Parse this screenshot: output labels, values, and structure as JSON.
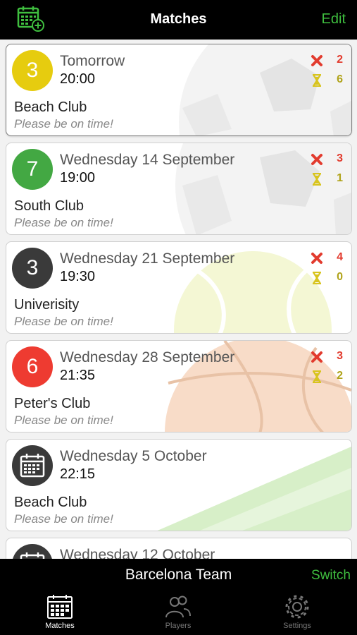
{
  "nav": {
    "title": "Matches",
    "edit_label": "Edit"
  },
  "colors": {
    "accent": "#3fbf3f",
    "no_icon": "#e23b2e",
    "pending_icon": "#d8c41e"
  },
  "matches": [
    {
      "badge": "3",
      "badge_color": "#e6cc0f",
      "badge_kind": "number",
      "date": "Tomorrow",
      "time": "20:00",
      "venue": "Beach Club",
      "note": "Please be on time!",
      "no_count": "2",
      "pending_count": "6",
      "background": "soccer-ball",
      "selected": true
    },
    {
      "badge": "7",
      "badge_color": "#43a843",
      "badge_kind": "number",
      "date": "Wednesday 14 September",
      "time": "19:00",
      "venue": "South Club",
      "note": "Please be on time!",
      "no_count": "3",
      "pending_count": "1",
      "background": "soccer-ball",
      "selected": false
    },
    {
      "badge": "3",
      "badge_color": "#3a3a3a",
      "badge_kind": "number",
      "date": "Wednesday 21 September",
      "time": "19:30",
      "venue": "Univerisity",
      "note": "Please be on time!",
      "no_count": "4",
      "pending_count": "0",
      "background": "tennis-ball",
      "selected": false
    },
    {
      "badge": "6",
      "badge_color": "#ee3b31",
      "badge_kind": "number",
      "date": "Wednesday 28 September",
      "time": "21:35",
      "venue": "Peter's Club",
      "note": "Please be on time!",
      "no_count": "3",
      "pending_count": "2",
      "background": "basketball",
      "selected": false
    },
    {
      "badge": "",
      "badge_color": "#3a3a3a",
      "badge_kind": "calendar",
      "date": "Wednesday 5 October",
      "time": "22:15",
      "venue": "Beach Club",
      "note": "Please be on time!",
      "no_count": "",
      "pending_count": "",
      "background": "grass-field",
      "selected": false
    },
    {
      "badge": "",
      "badge_color": "#3a3a3a",
      "badge_kind": "calendar",
      "date": "Wednesday 12 October",
      "time": "",
      "venue": "",
      "note": "",
      "no_count": "",
      "pending_count": "",
      "background": "none",
      "selected": false
    }
  ],
  "footer": {
    "team_name": "Barcelona Team",
    "switch_label": "Switch"
  },
  "tabs": [
    {
      "label": "Matches",
      "icon": "calendar-icon",
      "active": true
    },
    {
      "label": "Players",
      "icon": "players-icon",
      "active": false
    },
    {
      "label": "Settings",
      "icon": "gear-icon",
      "active": false
    }
  ]
}
